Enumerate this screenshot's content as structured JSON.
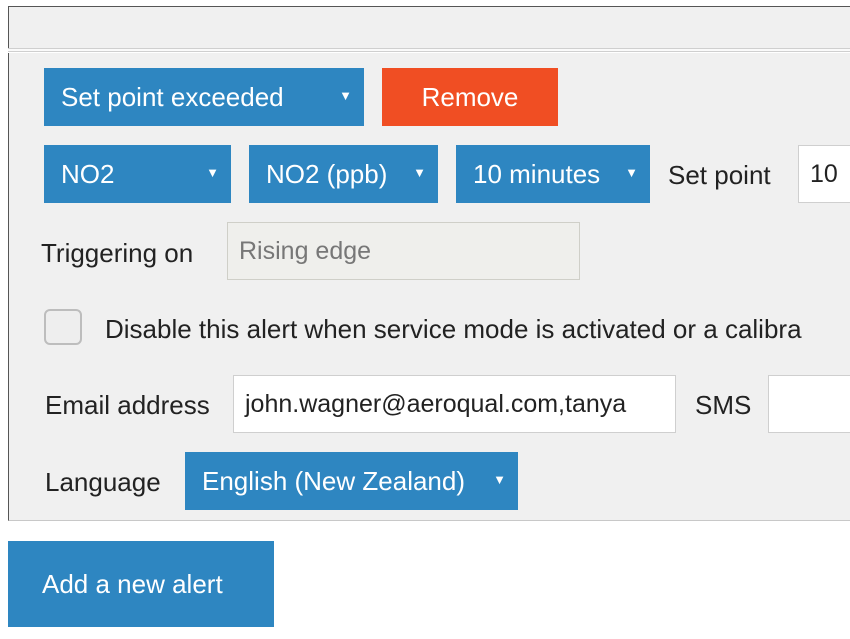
{
  "alert": {
    "condition_select": {
      "value": "Set point exceeded"
    },
    "remove_label": "Remove",
    "sensor_select": {
      "value": "NO2"
    },
    "unit_select": {
      "value": "NO2 (ppb)"
    },
    "interval_select": {
      "value": "10 minutes"
    },
    "setpoint_label": "Set point",
    "setpoint_value": "10",
    "triggering_label": "Triggering on",
    "triggering_value": "Rising edge",
    "disable_label": "Disable this alert when service mode is activated or a calibra",
    "disable_checked": false,
    "email_label": "Email address",
    "email_value": "john.wagner@aeroqual.com,tanya",
    "sms_label": "SMS",
    "sms_value": "",
    "language_label": "Language",
    "language_select": {
      "value": "English (New Zealand)"
    }
  },
  "add_alert_label": "Add a new alert",
  "colors": {
    "primary": "#2e86c1",
    "danger": "#f04e23",
    "panel": "#f0f0f0"
  },
  "icons": {
    "dropdown": "caret-down-icon"
  }
}
